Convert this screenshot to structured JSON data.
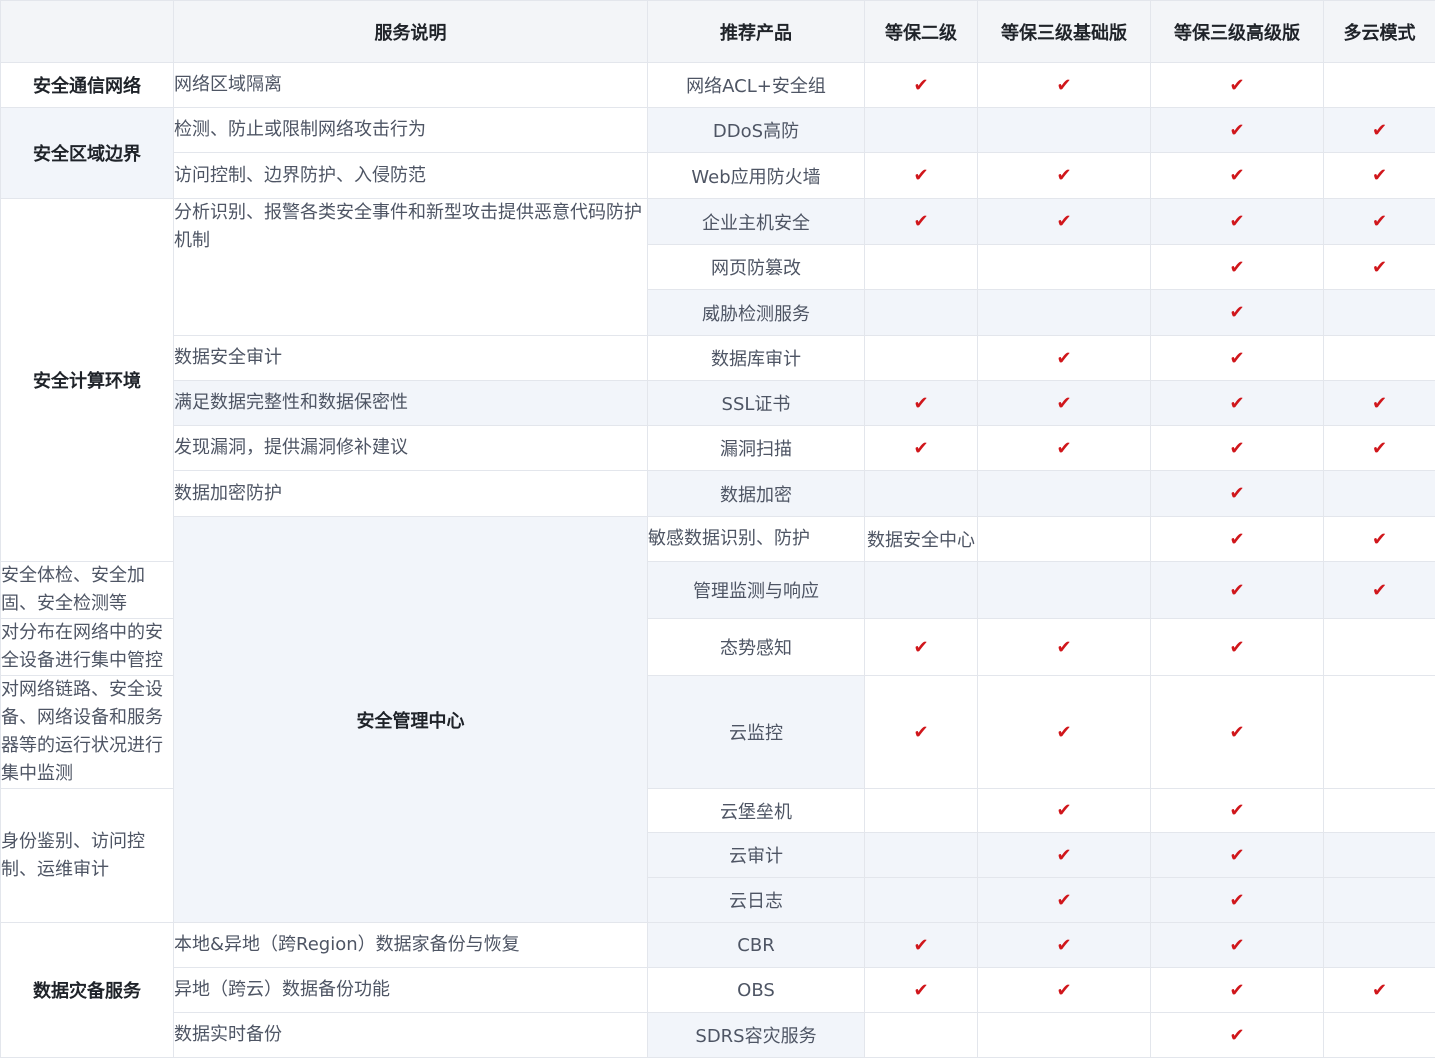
{
  "colors": {
    "check": "#d0161b",
    "header_bg": "#f3f5f8",
    "shade_bg": "#f2f5fa",
    "border": "#e3e6ec"
  },
  "check_icon": "checkmark-icon",
  "check_glyph": "✔",
  "headers": [
    "",
    "服务说明",
    "推荐产品",
    "等保二级",
    "等保三级基础版",
    "等保三级高级版",
    "多云模式"
  ],
  "categories": [
    "安全通信网络",
    "安全区域边界",
    "安全计算环境",
    "安全管理中心",
    "数据灾备服务"
  ],
  "descriptions": [
    "网络区域隔离",
    "检测、防止或限制网络攻击行为",
    "访问控制、边界防护、入侵防范",
    "分析识别、报警各类安全事件和新型攻击提供恶意代码防护机制",
    "数据安全审计",
    "满足数据完整性和数据保密性",
    "发现漏洞，提供漏洞修补建议",
    "数据加密防护",
    "敏感数据识别、防护",
    "安全体检、安全加固、安全检测等",
    "对分布在网络中的安全设备进行集中管控",
    "对网络链路、安全设备、网络设备和服务器等的运行状况进行集中监测",
    "身份鉴别、访问控制、运维审计",
    "本地&异地（跨Region）数据家备份与恢复",
    "异地（跨云）数据备份功能",
    "数据实时备份"
  ],
  "products": [
    {
      "name": "网络ACL+安全组",
      "checks": [
        true,
        true,
        true,
        false
      ]
    },
    {
      "name": "DDoS高防",
      "checks": [
        false,
        false,
        true,
        true
      ]
    },
    {
      "name": "Web应用防火墙",
      "checks": [
        true,
        true,
        true,
        true
      ]
    },
    {
      "name": "企业主机安全",
      "checks": [
        true,
        true,
        true,
        true
      ]
    },
    {
      "name": "网页防篡改",
      "checks": [
        false,
        false,
        true,
        true
      ]
    },
    {
      "name": "威胁检测服务",
      "checks": [
        false,
        false,
        true,
        false
      ]
    },
    {
      "name": "数据库审计",
      "checks": [
        false,
        true,
        true,
        false
      ]
    },
    {
      "name": "SSL证书",
      "checks": [
        true,
        true,
        true,
        true
      ]
    },
    {
      "name": "漏洞扫描",
      "checks": [
        true,
        true,
        true,
        true
      ]
    },
    {
      "name": "数据加密",
      "checks": [
        false,
        false,
        true,
        false
      ]
    },
    {
      "name": "数据安全中心",
      "checks": [
        false,
        true,
        true,
        false
      ]
    },
    {
      "name": "管理监测与响应",
      "checks": [
        false,
        false,
        true,
        true
      ]
    },
    {
      "name": "态势感知",
      "checks": [
        true,
        true,
        true,
        false
      ]
    },
    {
      "name": "云监控",
      "checks": [
        true,
        true,
        true,
        false
      ]
    },
    {
      "name": "云堡垒机",
      "checks": [
        false,
        true,
        true,
        false
      ]
    },
    {
      "name": "云审计",
      "checks": [
        false,
        true,
        true,
        false
      ]
    },
    {
      "name": "云日志",
      "checks": [
        false,
        true,
        true,
        false
      ]
    },
    {
      "name": "CBR",
      "checks": [
        true,
        true,
        true,
        false
      ]
    },
    {
      "name": "OBS",
      "checks": [
        true,
        true,
        true,
        true
      ]
    },
    {
      "name": "SDRS容灾服务",
      "checks": [
        false,
        false,
        true,
        false
      ]
    }
  ]
}
